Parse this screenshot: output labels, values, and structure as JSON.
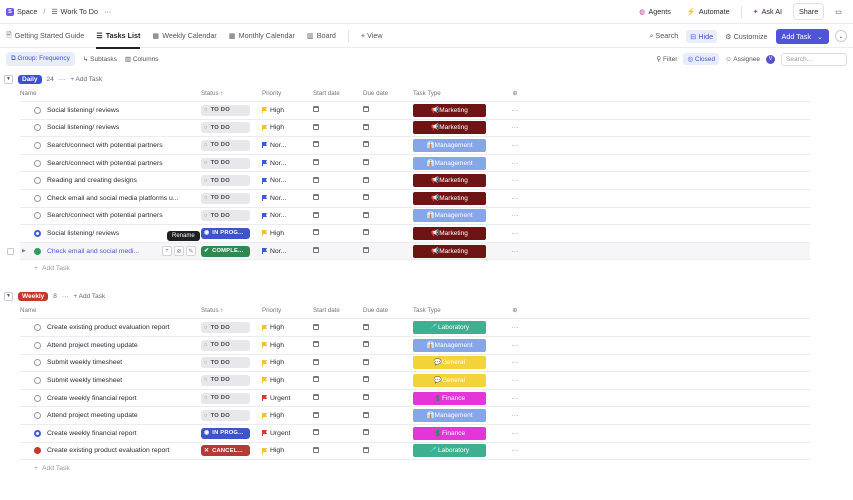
{
  "topbar": {
    "space_label": "Space",
    "space_icon": "S",
    "separator": "/",
    "list_name": "Work To Do",
    "more": "···",
    "agents": "Agents",
    "automate": "Automate",
    "ask_ai": "Ask AI",
    "share": "Share"
  },
  "views": {
    "tabs": [
      {
        "label": "Getting Started Guide"
      },
      {
        "label": "Tasks List"
      },
      {
        "label": "Weekly Calendar"
      },
      {
        "label": "Monthly Calendar"
      },
      {
        "label": "Board"
      },
      {
        "label": "+ View"
      }
    ],
    "search": "Search",
    "hide": "Hide",
    "customize": "Customize",
    "add_task": "Add Task"
  },
  "filters": {
    "group": "Group: Frequency",
    "subtasks": "Subtasks",
    "columns": "Columns",
    "filter": "Filter",
    "closed": "Closed",
    "assignee": "Assignee",
    "avatar": "V",
    "search_placeholder": "Search..."
  },
  "columns": {
    "name": "Name",
    "status": "Status",
    "priority": "Priority",
    "start": "Start date",
    "due": "Due date",
    "type": "Task Type"
  },
  "tooltip": "Rename",
  "colors": {
    "Marketing": "#6f1414",
    "Management": "#87a6e8",
    "Laboratory": "#3fb08f",
    "General": "#f2d43a",
    "Finance": "#e335d8",
    "High": "#f2c234",
    "Normal": "#3d5bd9",
    "Urgent": "#d23b2e"
  },
  "groups": [
    {
      "label": "Daily",
      "color": "#3d4fd9",
      "count": "24",
      "more": "···",
      "add": "+ Add Task",
      "rows": [
        {
          "name": "Social listening/ reviews",
          "status": "TO DO",
          "st": "todo",
          "priority": "High",
          "type": "Marketing",
          "type_label": "📢Marketing"
        },
        {
          "name": "Social listening/ reviews",
          "status": "TO DO",
          "st": "todo",
          "priority": "High",
          "type": "Marketing",
          "type_label": "📢Marketing"
        },
        {
          "name": "Search/connect with potential partners",
          "status": "TO DO",
          "st": "todo",
          "priority": "Nor...",
          "pkey": "Normal",
          "type": "Management",
          "type_label": "👔Management"
        },
        {
          "name": "Search/connect with potential partners",
          "status": "TO DO",
          "st": "todo",
          "priority": "Nor...",
          "pkey": "Normal",
          "type": "Management",
          "type_label": "👔Management"
        },
        {
          "name": "Reading and creating designs",
          "status": "TO DO",
          "st": "todo",
          "priority": "Nor...",
          "pkey": "Normal",
          "type": "Marketing",
          "type_label": "📢Marketing"
        },
        {
          "name": "Check email and social media platforms u...",
          "status": "TO DO",
          "st": "todo",
          "priority": "Nor...",
          "pkey": "Normal",
          "type": "Marketing",
          "type_label": "📢Marketing"
        },
        {
          "name": "Search/connect with potential partners",
          "status": "TO DO",
          "st": "todo",
          "priority": "Nor...",
          "pkey": "Normal",
          "type": "Management",
          "type_label": "👔Management"
        },
        {
          "name": "Social listening/ reviews",
          "status": "IN PROG...",
          "st": "prog",
          "priority": "High",
          "type": "Marketing",
          "type_label": "📢Marketing"
        },
        {
          "name": "Check email and social medi...",
          "status": "COMPLE...",
          "st": "done",
          "priority": "Nor...",
          "pkey": "Normal",
          "type": "Marketing",
          "type_label": "📢Marketing",
          "hover": true
        }
      ],
      "add_row": "Add Task"
    },
    {
      "label": "Weekly",
      "color": "#c0392b",
      "count": "8",
      "more": "···",
      "add": "+ Add Task",
      "rows": [
        {
          "name": "Create existing product evaluation report",
          "status": "TO DO",
          "st": "todo",
          "priority": "High",
          "type": "Laboratory",
          "type_label": "🧪Laboratory"
        },
        {
          "name": "Attend project meeting update",
          "status": "TO DO",
          "st": "todo",
          "priority": "High",
          "type": "Management",
          "type_label": "👔Management"
        },
        {
          "name": "Submit weekly timesheet",
          "status": "TO DO",
          "st": "todo",
          "priority": "High",
          "type": "General",
          "type_label": "💬General"
        },
        {
          "name": "Submit weekly timesheet",
          "status": "TO DO",
          "st": "todo",
          "priority": "High",
          "type": "General",
          "type_label": "💬General"
        },
        {
          "name": "Create weekly financial report",
          "status": "TO DO",
          "st": "todo",
          "priority": "Urgent",
          "type": "Finance",
          "type_label": "💲Finance"
        },
        {
          "name": "Attend project meeting update",
          "status": "TO DO",
          "st": "todo",
          "priority": "High",
          "type": "Management",
          "type_label": "👔Management"
        },
        {
          "name": "Create weekly financial report",
          "status": "IN PROG...",
          "st": "prog",
          "priority": "Urgent",
          "type": "Finance",
          "type_label": "💲Finance"
        },
        {
          "name": "Create existing product evaluation report",
          "status": "CANCEL...",
          "st": "cancel",
          "priority": "High",
          "type": "Laboratory",
          "type_label": "🧪Laboratory"
        }
      ],
      "add_row": "Add Task"
    }
  ]
}
